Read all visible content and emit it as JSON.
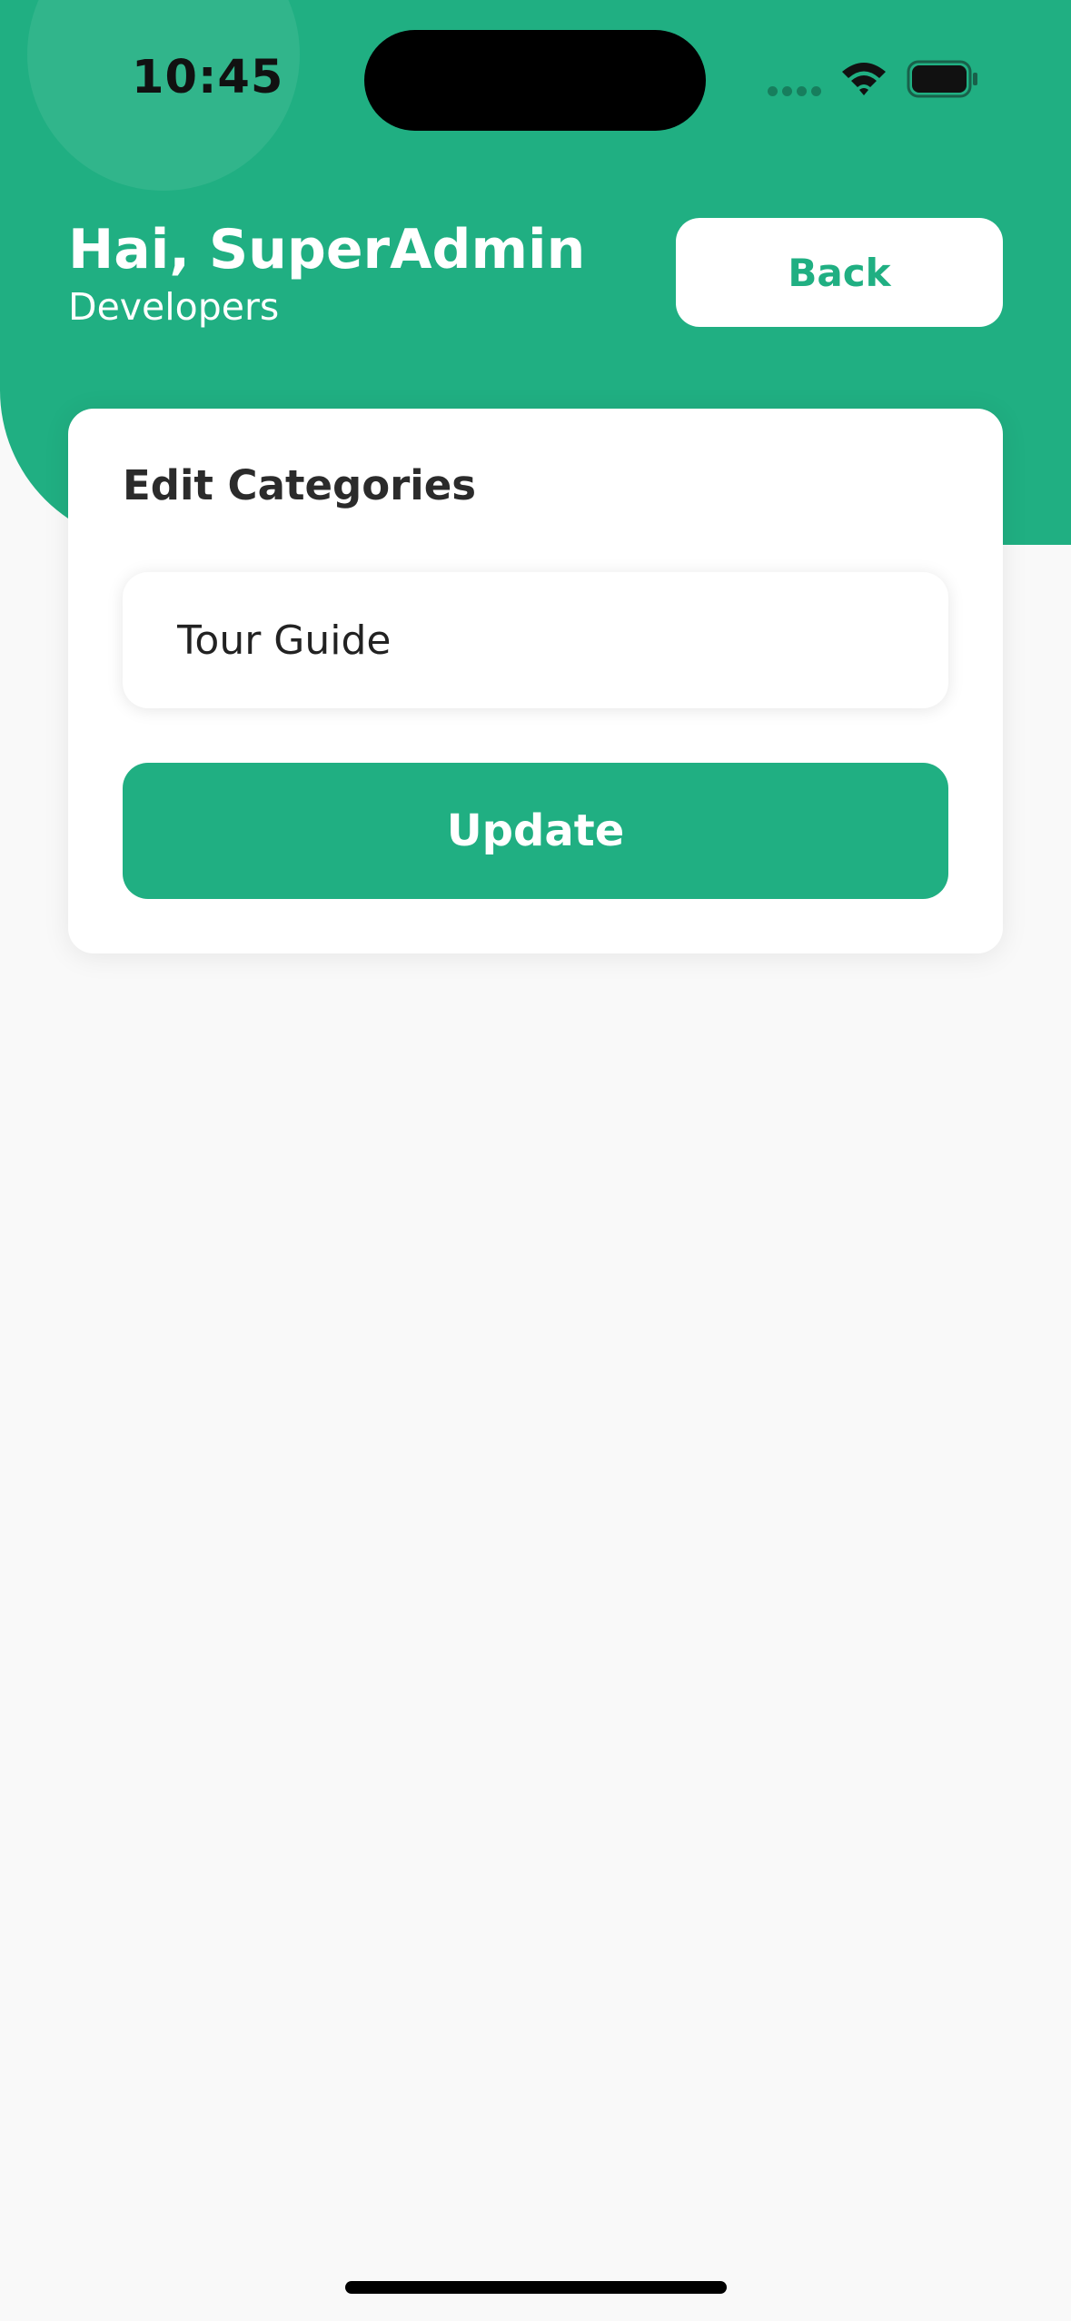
{
  "status_bar": {
    "time": "10:45"
  },
  "header": {
    "greeting": "Hai, SuperAdmin",
    "subtitle": "Developers",
    "back_label": "Back"
  },
  "form": {
    "title": "Edit Categories",
    "category_value": "Tour Guide",
    "update_label": "Update"
  },
  "colors": {
    "accent": "#20af82",
    "background": "#f9f9f9",
    "card": "#ffffff"
  }
}
